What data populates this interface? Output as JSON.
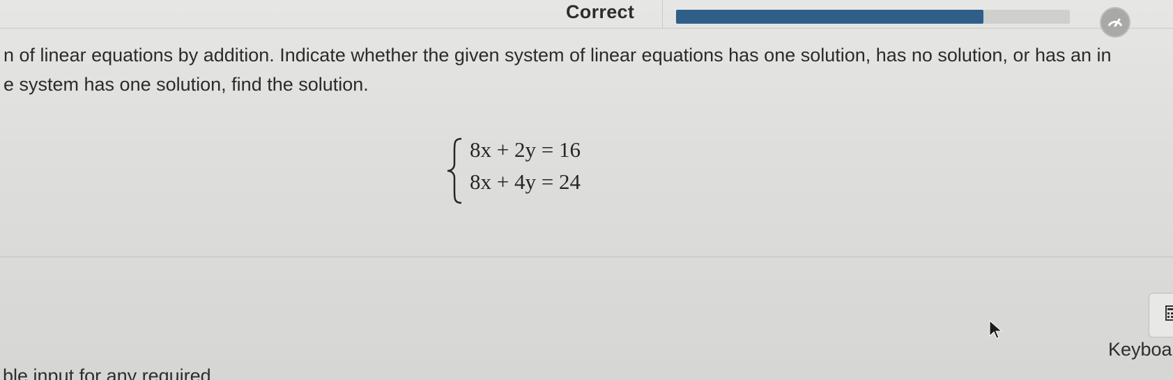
{
  "header": {
    "status_label": "Correct",
    "progress_fraction": 0.78
  },
  "question": {
    "line1": "n of linear equations by addition. Indicate whether the given system of linear equations has one solution, has no solution, or has an in",
    "line2": "e system has one solution, find the solution.",
    "equation1": "8x + 2y = 16",
    "equation2": "8x + 4y = 24"
  },
  "tools": {
    "calculator_icon": "calculator-icon",
    "keyboard_label": "Keyboa"
  },
  "footer": {
    "partial_text": "ble input for any required"
  },
  "colors": {
    "progress": "#2f5f88",
    "background": "#dcdcda"
  }
}
